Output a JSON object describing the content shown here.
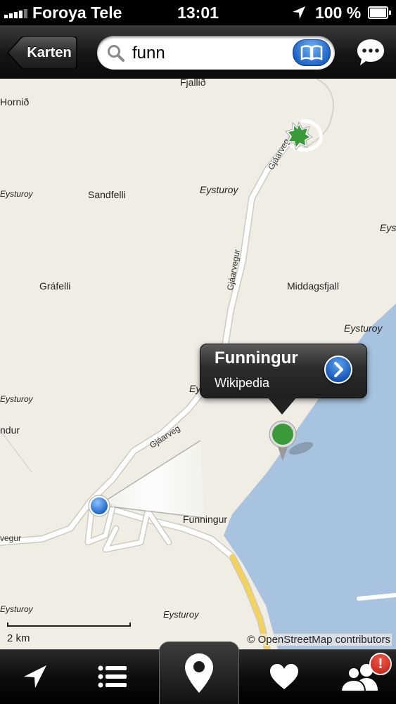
{
  "status_bar": {
    "carrier": "Foroya Tele",
    "time": "13:01",
    "battery": "100 %",
    "icons": [
      "signal-bars-icon",
      "location-arrow-icon",
      "battery-icon"
    ]
  },
  "nav_bar": {
    "back_label": "Karten",
    "search_value": "funn",
    "icons": [
      "search-icon",
      "book-icon",
      "chat-bubble-icon"
    ]
  },
  "map": {
    "labels": {
      "fjallid": "Fjallið",
      "hornid": "Hornið",
      "sandfelli": "Sandfelli",
      "grafelli": "Gráfelli",
      "middagsfjall": "Middagsfjall",
      "funningur_town": "Funningur",
      "ndur": "ndur",
      "eysturoy_1": "Eysturoy",
      "eysturoy_2": "Eysturoy",
      "eysturoy_3": "Eysturoy",
      "eysturoy_4": "Eysturoy",
      "eysturoy_5": "Eysturoy",
      "eysturoy_6": "Eysturoy",
      "eysturoy_7": "Eysturoy",
      "eysturoy_8": "Eysturoy",
      "eysturoy_9": "Eysturoy",
      "eysturoy_10": "Eysturoy",
      "road_1": "Gjáarvegur",
      "road_2": "Gjáarveg",
      "road_3": "Gjáarveg",
      "road_4": "vegur"
    },
    "callout": {
      "title": "Funningur",
      "subtitle": "Wikipedia"
    },
    "scale_label": "2 km",
    "attribution": "© OpenStreetMap contributors",
    "colors": {
      "land": "#f0ede5",
      "water": "#a7c3e0",
      "road": "#ffffff",
      "highway": "#f3d35a",
      "pin_green": "#3a9a3a",
      "user_blue": "#2c7be5"
    }
  },
  "tab_bar": {
    "tabs": [
      "location-arrow-icon",
      "list-icon",
      "map-pin-icon",
      "heart-icon",
      "people-icon"
    ],
    "badge": "!"
  }
}
